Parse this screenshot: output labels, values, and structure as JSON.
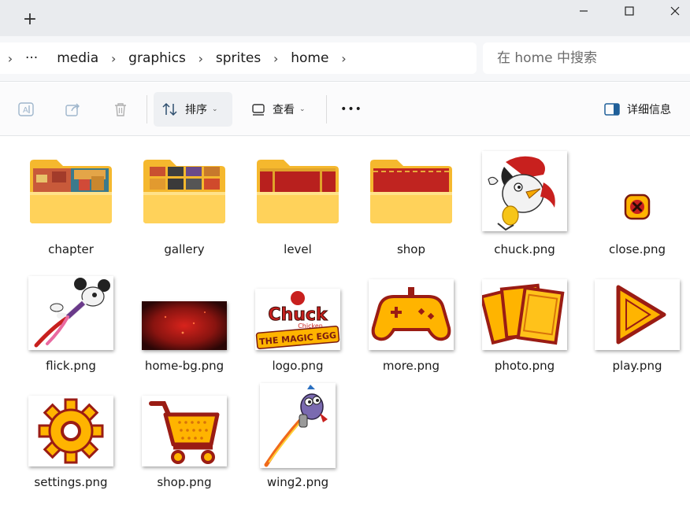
{
  "window": {
    "new_tab_glyph": "+",
    "controls": [
      "minimize-icon",
      "maximize-icon",
      "close-icon"
    ]
  },
  "address": {
    "more_glyph": "···",
    "crumbs": [
      "media",
      "graphics",
      "sprites",
      "home"
    ],
    "chevron_glyph": "›"
  },
  "search": {
    "placeholder": "在 home 中搜索"
  },
  "toolbar": {
    "sort_label": "排序",
    "view_label": "查看",
    "more_glyph": "•••",
    "details_label": "详细信息",
    "chev_glyph": "⌄"
  },
  "colors": {
    "accent": "#0067c0",
    "folder_back": "#f5b82e",
    "folder_front": "#ffd25a",
    "sprite_red": "#c8201e",
    "sprite_yellow": "#ffb400"
  },
  "files": [
    {
      "name": "chapter",
      "type": "folder",
      "preview": "stage"
    },
    {
      "name": "gallery",
      "type": "folder",
      "preview": "thumbs"
    },
    {
      "name": "level",
      "type": "folder",
      "preview": "red"
    },
    {
      "name": "shop",
      "type": "folder",
      "preview": "red2"
    },
    {
      "name": "chuck.png",
      "type": "image",
      "preview": "chicken"
    },
    {
      "name": "close.png",
      "type": "image",
      "preview": "close"
    },
    {
      "name": "flick.png",
      "type": "image",
      "preview": "mouse"
    },
    {
      "name": "home-bg.png",
      "type": "image",
      "preview": "bg"
    },
    {
      "name": "logo.png",
      "type": "image",
      "preview": "logo"
    },
    {
      "name": "more.png",
      "type": "image",
      "preview": "gamepad"
    },
    {
      "name": "photo.png",
      "type": "image",
      "preview": "photo"
    },
    {
      "name": "play.png",
      "type": "image",
      "preview": "play"
    },
    {
      "name": "settings.png",
      "type": "image",
      "preview": "gear"
    },
    {
      "name": "shop.png",
      "type": "image",
      "preview": "cart"
    },
    {
      "name": "wing2.png",
      "type": "image",
      "preview": "rocket"
    }
  ],
  "logo_text": {
    "line1": "Chuck",
    "line2": "Chicken",
    "line3": "THE MAGIC EGG"
  }
}
